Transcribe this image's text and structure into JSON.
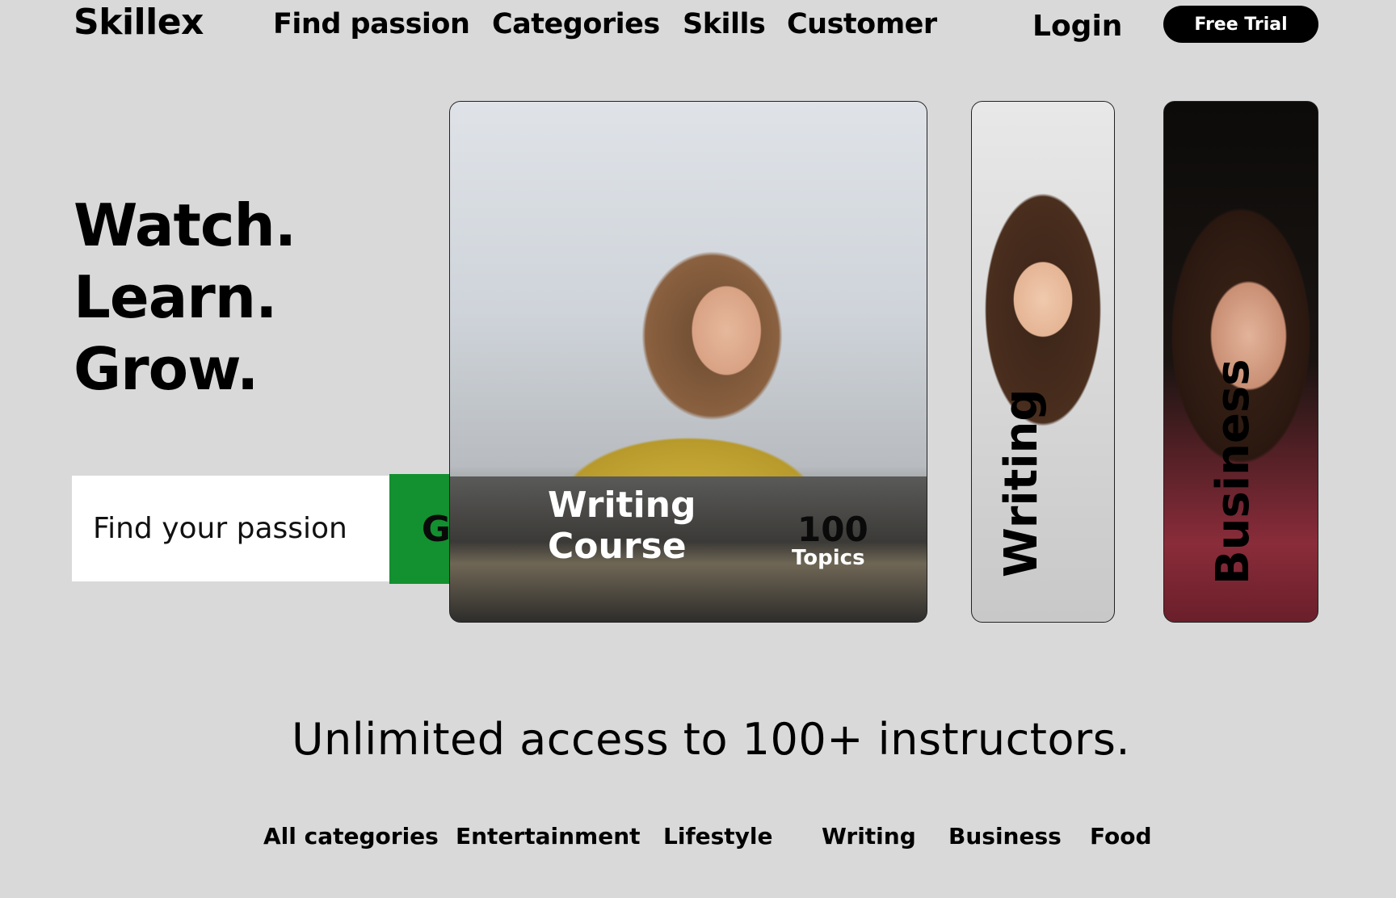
{
  "brand": {
    "name": "Skillex"
  },
  "nav": {
    "items": [
      "Find passion",
      "Categories",
      "Skills",
      "Customer"
    ],
    "login": "Login",
    "cta": "Free Trial"
  },
  "hero": {
    "lines": [
      "Watch.",
      "Learn.",
      "Grow."
    ],
    "search": {
      "placeholder": "Find your passion",
      "value": "",
      "button": "Go"
    }
  },
  "cards": {
    "main": {
      "title_line1": "Writing",
      "title_line2": "Course",
      "count": "100",
      "count_label": "Topics"
    },
    "writing": {
      "label": "Writing"
    },
    "business": {
      "label": "Business"
    }
  },
  "tagline": "Unlimited access to 100+ instructors.",
  "categories": [
    "All categories",
    "Entertainment",
    "Lifestyle",
    "Writing",
    "Business",
    "Food"
  ],
  "colors": {
    "background": "#d9d9d9",
    "accent": "#13902f",
    "cta": "#000000"
  }
}
